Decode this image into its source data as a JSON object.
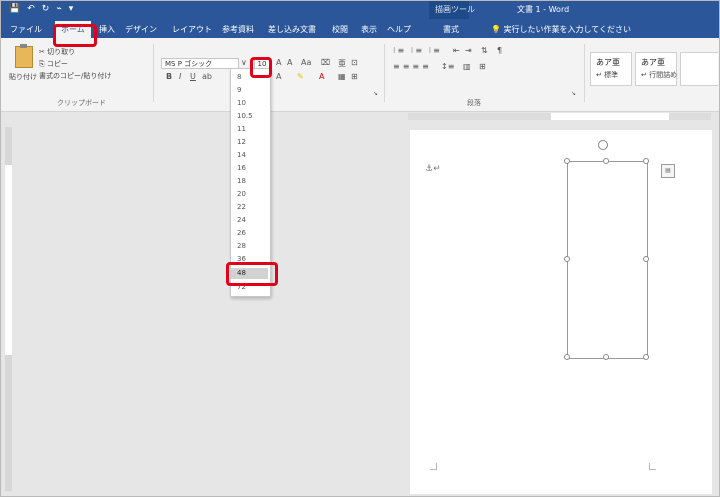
{
  "titlebar": {
    "qat": [
      "💾",
      "↶",
      "↻",
      "⌁",
      "▾"
    ],
    "context_tab": "描画ツール",
    "doc_title": "文書 1 - Word"
  },
  "tabs": [
    {
      "label": "ファイル"
    },
    {
      "label": "ホーム"
    },
    {
      "label": "挿入"
    },
    {
      "label": "デザイン"
    },
    {
      "label": "レイアウト"
    },
    {
      "label": "参考資料"
    },
    {
      "label": "差し込み文書"
    },
    {
      "label": "校閲"
    },
    {
      "label": "表示"
    },
    {
      "label": "ヘルプ"
    },
    {
      "label": "書式"
    }
  ],
  "tellme": "実行したい作業を入力してください",
  "ribbon": {
    "paste_label": "貼り付け",
    "cut_label": "✂ 切り取り",
    "copy_label": "⎘ コピー",
    "format_painter_label": "書式のコピー/貼り付け",
    "clipboard_group": "クリップボード",
    "font_name": "MS P ゴシック",
    "font_size": "10",
    "paragraph_group": "段落",
    "style1_name": "あア亜",
    "style1_label": "↵ 標準",
    "style2_name": "あア亜",
    "style2_label": "↵ 行間詰め"
  },
  "font_size_dropdown": {
    "options": [
      "8",
      "9",
      "10",
      "10.5",
      "11",
      "12",
      "14",
      "16",
      "18",
      "20",
      "22",
      "24",
      "26",
      "28",
      "36",
      "48",
      "72"
    ],
    "selected": "48"
  }
}
